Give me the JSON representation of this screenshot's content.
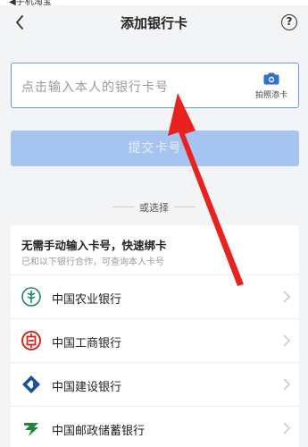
{
  "status": {
    "text": "◀手机淘宝"
  },
  "header": {
    "title": "添加银行卡",
    "help_symbol": "?"
  },
  "card_input": {
    "placeholder": "点击输入本人的银行卡号",
    "photo_label": "拍照添卡"
  },
  "submit": {
    "label": "提交卡号"
  },
  "divider": {
    "label": "或选择"
  },
  "quick_bind": {
    "title": "无需手动输入卡号，快速绑卡",
    "subtitle": "已和以下银行合作，可查询本人卡号",
    "banks": [
      {
        "name": "中国农业银行",
        "icon": "abc-bank-icon",
        "color": "#1a8a6a"
      },
      {
        "name": "中国工商银行",
        "icon": "icbc-bank-icon",
        "color": "#d4261e"
      },
      {
        "name": "中国建设银行",
        "icon": "ccb-bank-icon",
        "color": "#1d4f9a"
      },
      {
        "name": "中国邮政储蓄银行",
        "icon": "psbc-bank-icon",
        "color": "#1a8a3a"
      }
    ]
  },
  "colors": {
    "accent": "#6a98d8",
    "submit_disabled": "#a6c4f0",
    "arrow": "#e8231f"
  }
}
